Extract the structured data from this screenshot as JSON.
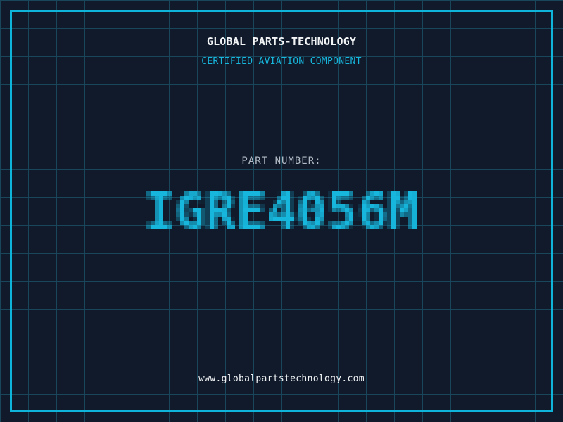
{
  "header": {
    "company_name": "GLOBAL PARTS-TECHNOLOGY",
    "certification": "CERTIFIED AVIATION COMPONENT"
  },
  "part_number": {
    "label": "PART NUMBER:",
    "value": "IGRE4056M"
  },
  "footer": {
    "website": "www.globalpartstechnology.com"
  },
  "colors": {
    "background": "#101a2b",
    "grid_line": "#19465b",
    "frame_border": "#0eb4da",
    "accent_cyan": "#17b6dc",
    "text_white": "#f2f4f6",
    "text_gray": "#b3bcc6"
  }
}
